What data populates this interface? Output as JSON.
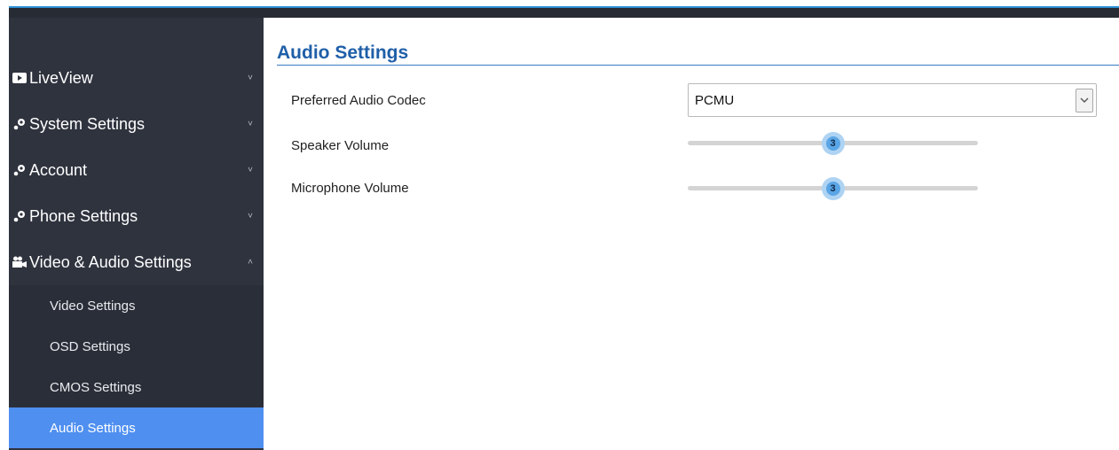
{
  "sidebar": {
    "items": [
      {
        "label": "LiveView",
        "icon": "video-icon",
        "chevron": "˅"
      },
      {
        "label": "System Settings",
        "icon": "gear-icon",
        "chevron": "˅"
      },
      {
        "label": "Account",
        "icon": "gear-icon",
        "chevron": "˅"
      },
      {
        "label": "Phone Settings",
        "icon": "gear-icon",
        "chevron": "˅"
      },
      {
        "label": "Video & Audio Settings",
        "icon": "camera-icon",
        "chevron": "˄"
      }
    ],
    "subitems": [
      {
        "label": "Video Settings"
      },
      {
        "label": "OSD Settings"
      },
      {
        "label": "CMOS Settings"
      },
      {
        "label": "Audio Settings",
        "active": true
      }
    ]
  },
  "main": {
    "title": "Audio Settings",
    "codec": {
      "label": "Preferred Audio Codec",
      "value": "PCMU"
    },
    "speaker": {
      "label": "Speaker Volume",
      "value": "3",
      "fraction": 0.5
    },
    "microphone": {
      "label": "Microphone Volume",
      "value": "3",
      "fraction": 0.5
    }
  },
  "colors": {
    "accent": "#4f8ff0",
    "title": "#1f5fa8",
    "sidebar": "#2f333e"
  }
}
